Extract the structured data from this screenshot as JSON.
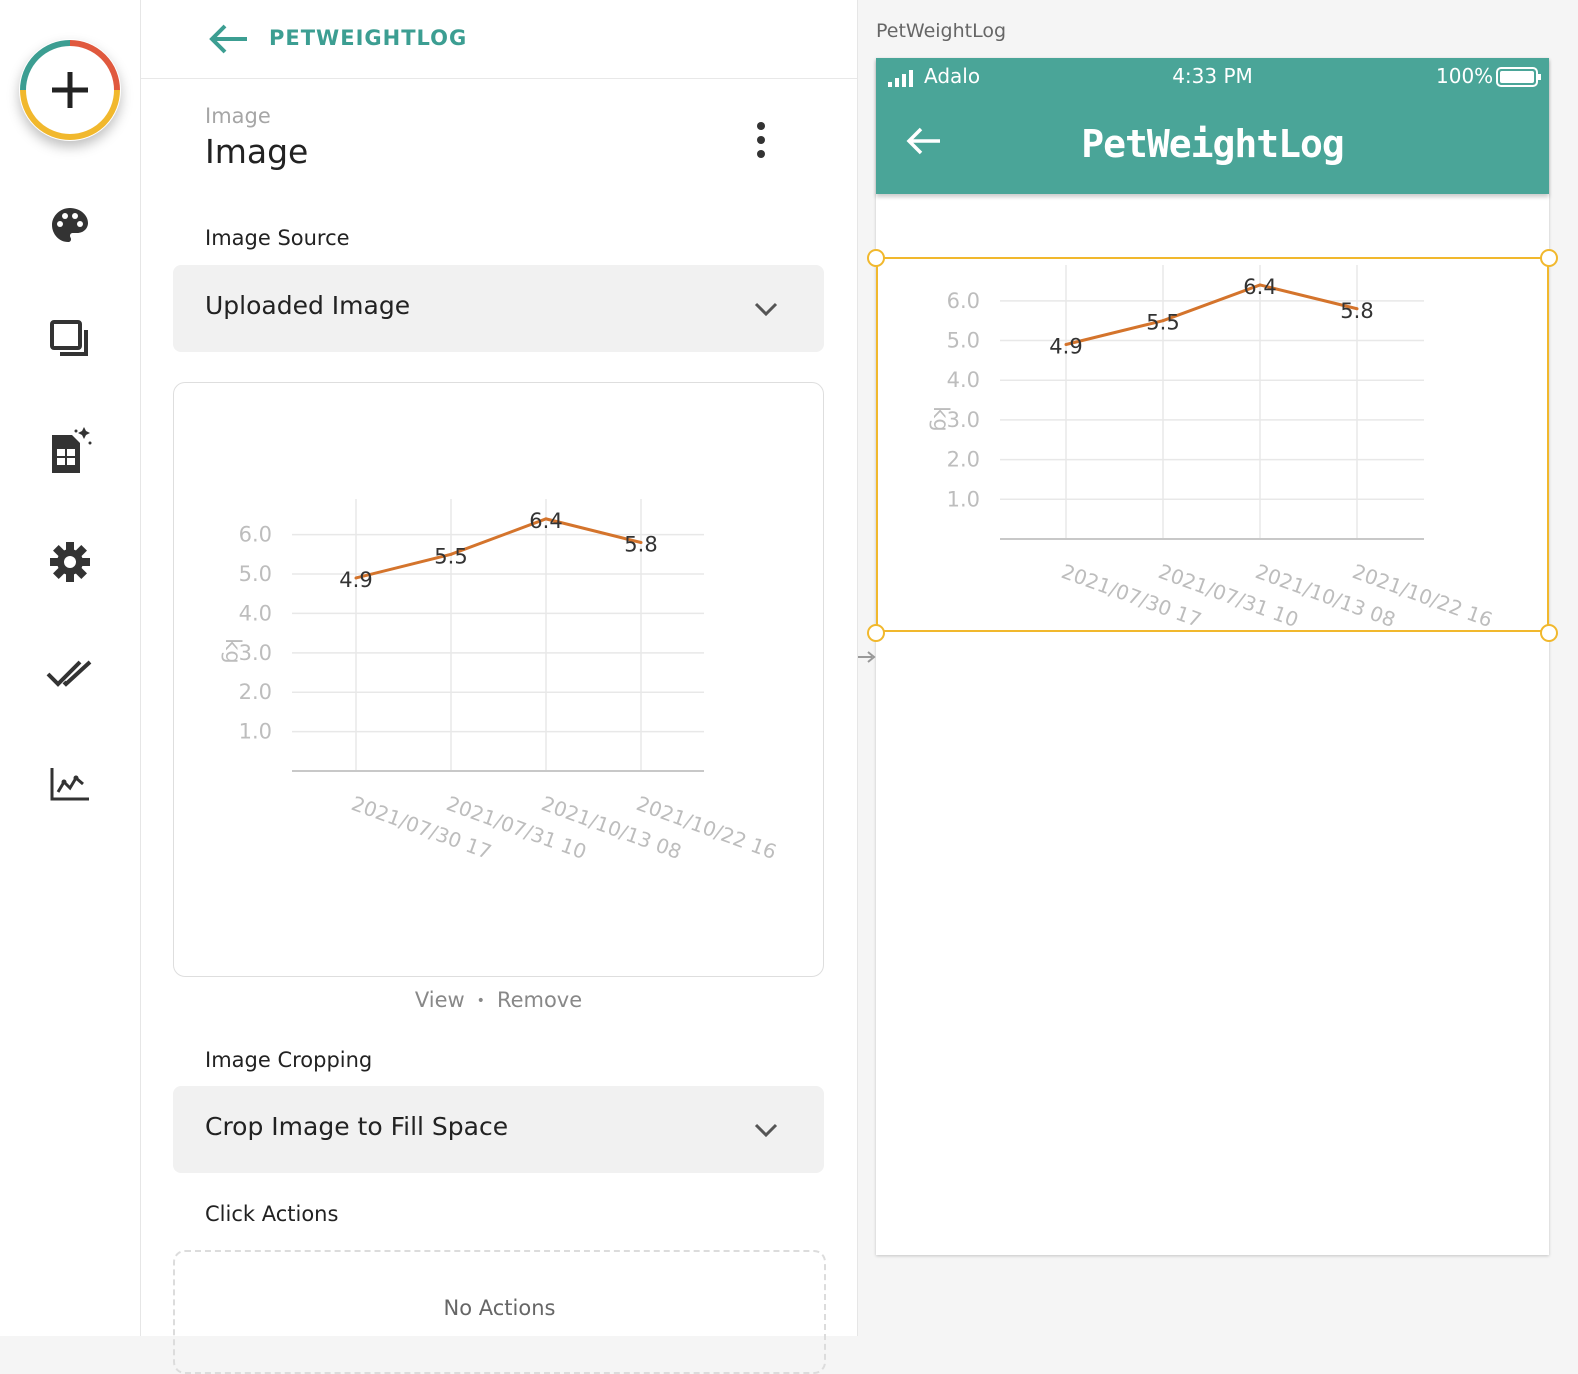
{
  "sidebar": {
    "add_icon": "plus-icon",
    "items": [
      {
        "name": "palette-icon"
      },
      {
        "name": "screens-icon"
      },
      {
        "name": "database-icon"
      },
      {
        "name": "gear-icon"
      },
      {
        "name": "checks-icon"
      },
      {
        "name": "analytics-icon"
      }
    ]
  },
  "panel": {
    "app_name": "PETWEIGHTLOG",
    "component_subtitle": "Image",
    "component_title": "Image",
    "image_source_label": "Image Source",
    "image_source_value": "Uploaded Image",
    "view_link": "View",
    "separator": "•",
    "remove_link": "Remove",
    "cropping_label": "Image Cropping",
    "cropping_value": "Crop Image to Fill Space",
    "click_actions_label": "Click Actions",
    "no_actions": "No Actions"
  },
  "canvas": {
    "screen_label": "PetWeightLog",
    "carrier": "Adalo",
    "time": "4:33 PM",
    "battery": "100%",
    "title": "PetWeightLog"
  },
  "colors": {
    "accent": "#3c9e92",
    "topbar": "#4aa598",
    "line": "#d4742c",
    "selection": "#f1b82d"
  },
  "chart_data": {
    "type": "line",
    "categories": [
      "2021/07/30 17",
      "2021/07/31 10",
      "2021/10/13 08",
      "2021/10/22 16"
    ],
    "values": [
      4.9,
      5.5,
      6.4,
      5.8
    ],
    "value_labels": [
      "4.9",
      "5.5",
      "6.4",
      "5.8"
    ],
    "yticks": [
      "6.0",
      "5.0",
      "4.0",
      "3.0",
      "2.0",
      "1.0"
    ],
    "ytick_values": [
      6,
      5,
      4,
      3,
      2,
      1
    ],
    "ylabel": "kg",
    "ylim": [
      0,
      6.6
    ],
    "grid": true
  }
}
